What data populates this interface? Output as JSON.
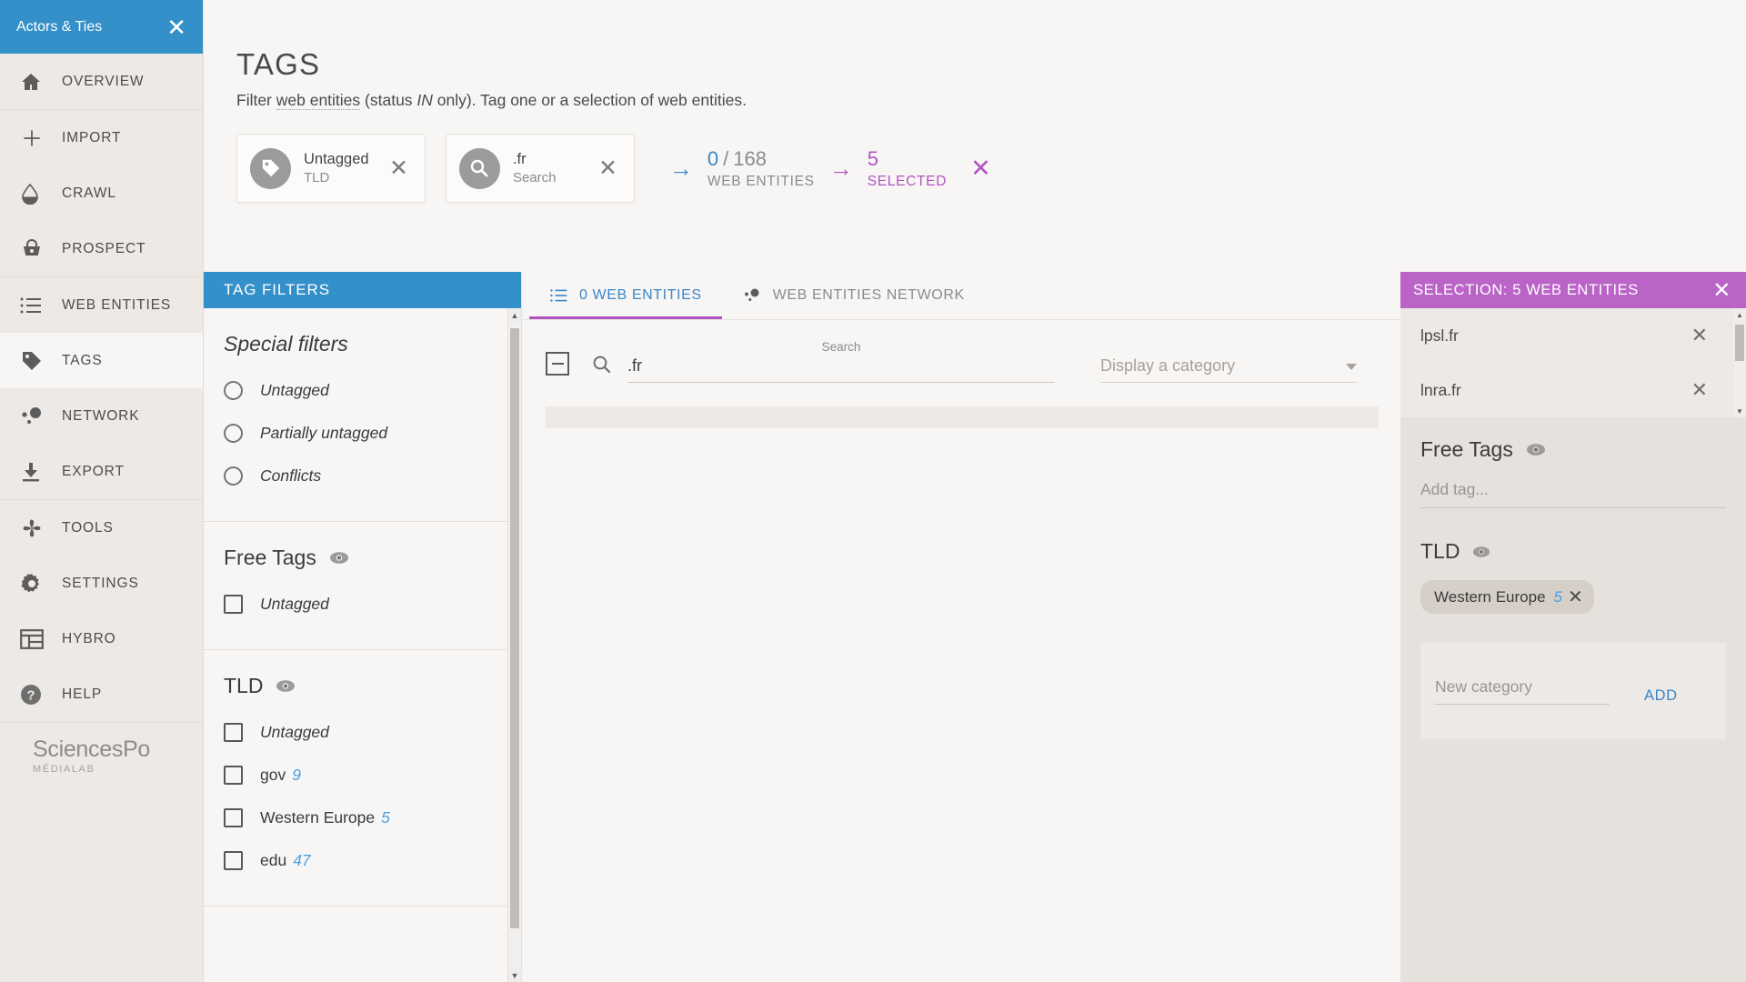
{
  "sidebar": {
    "title": "Actors & Ties",
    "close_icon": "close-icon",
    "groups": [
      {
        "items": [
          {
            "label": "OVERVIEW",
            "icon": "home-icon",
            "active": false
          }
        ]
      },
      {
        "items": [
          {
            "label": "IMPORT",
            "icon": "plus-icon",
            "active": false
          },
          {
            "label": "CRAWL",
            "icon": "drop-icon",
            "active": false
          },
          {
            "label": "PROSPECT",
            "icon": "basket-icon",
            "active": false
          }
        ]
      },
      {
        "items": [
          {
            "label": "WEB ENTITIES",
            "icon": "list-icon",
            "active": false
          },
          {
            "label": "TAGS",
            "icon": "tag-icon",
            "active": true
          },
          {
            "label": "NETWORK",
            "icon": "network-icon",
            "active": false
          },
          {
            "label": "EXPORT",
            "icon": "download-icon",
            "active": false
          }
        ]
      },
      {
        "items": [
          {
            "label": "TOOLS",
            "icon": "pinwheel-icon",
            "active": false
          },
          {
            "label": "SETTINGS",
            "icon": "gear-icon",
            "active": false
          },
          {
            "label": "HYBRO",
            "icon": "panel-icon",
            "active": false
          },
          {
            "label": "HELP",
            "icon": "question-icon",
            "active": false
          }
        ]
      }
    ],
    "logo": {
      "name": "SciencesPo",
      "sub": "MÉDIALAB"
    }
  },
  "header": {
    "title": "TAGS",
    "subtitle_a": "Filter ",
    "subtitle_link": "web entities",
    "subtitle_b": " (status ",
    "subtitle_em": "IN",
    "subtitle_c": " only). Tag one or a selection of web entities."
  },
  "filters": {
    "chips": [
      {
        "icon": "tag-icon",
        "main": "Untagged",
        "sub": "TLD",
        "remove": "✕"
      },
      {
        "icon": "search-icon",
        "main": ".fr",
        "sub": "Search",
        "remove": "✕"
      }
    ],
    "arrow_blue": "→",
    "entities_count": "0",
    "entities_sep": "/",
    "entities_total": "168",
    "entities_label": "WEB ENTITIES",
    "arrow_purple": "→",
    "selected_count": "5",
    "selected_label": "SELECTED",
    "selected_clear": "✕"
  },
  "tag_filters": {
    "panel_title": "TAG FILTERS",
    "special": {
      "title": "Special filters",
      "options": [
        {
          "label": "Untagged"
        },
        {
          "label": "Partially untagged"
        },
        {
          "label": "Conflicts"
        }
      ]
    },
    "free_tags": {
      "title": "Free Tags",
      "eye": "eye-icon",
      "options": [
        {
          "label": "Untagged",
          "count": ""
        }
      ]
    },
    "tld": {
      "title": "TLD",
      "eye": "eye-icon",
      "options": [
        {
          "label": "Untagged",
          "count": ""
        },
        {
          "label": "gov",
          "count": "9"
        },
        {
          "label": "Western Europe",
          "count": "5"
        },
        {
          "label": "edu",
          "count": "47"
        }
      ]
    }
  },
  "center": {
    "tabs": [
      {
        "label": "0 WEB ENTITIES",
        "icon": "list-icon",
        "active": true
      },
      {
        "label": "WEB ENTITIES NETWORK",
        "icon": "network-icon",
        "active": false
      }
    ],
    "search": {
      "label": "Search",
      "value": ".fr",
      "icon": "search-icon"
    },
    "category_select": {
      "value": "Display a category"
    }
  },
  "selection": {
    "header": "SELECTION: 5 WEB ENTITIES",
    "close": "✕",
    "items": [
      {
        "name": "lpsl.fr",
        "remove": "✕"
      },
      {
        "name": "lnra.fr",
        "remove": "✕"
      }
    ],
    "free_tags": {
      "title": "Free Tags",
      "eye": "eye-icon",
      "add_placeholder": "Add tag..."
    },
    "tld": {
      "title": "TLD",
      "eye": "eye-icon",
      "chips": [
        {
          "label": "Western Europe",
          "count": "5",
          "remove": "✕"
        }
      ]
    },
    "new_category": {
      "placeholder": "New category",
      "add_label": "ADD"
    }
  },
  "colors": {
    "blue": "#3490c8",
    "purple": "#b254c0",
    "selection_header": "#b964c6",
    "link_blue": "#4a9fe0",
    "sidebar_bg": "#ece9e6"
  }
}
